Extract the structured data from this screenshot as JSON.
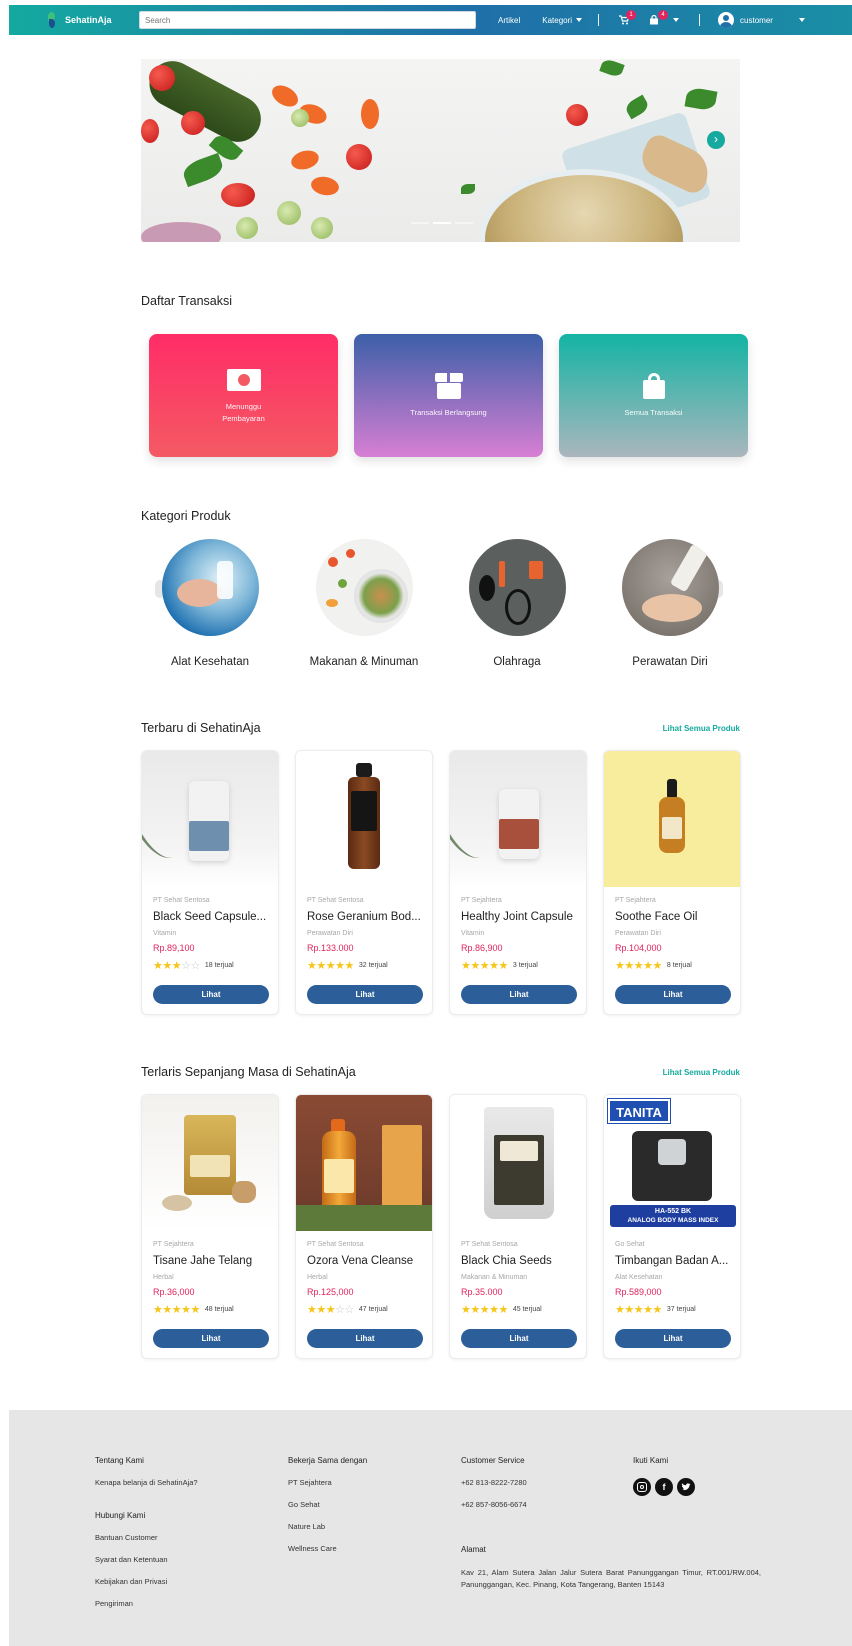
{
  "brand": {
    "name": "SehatinAja"
  },
  "navbar": {
    "search_placeholder": "Search",
    "artikel": "Artikel",
    "kategori": "Kategori",
    "cart_badge": "1",
    "bag_badge": "4",
    "user_name": "customer"
  },
  "transactions": {
    "title": "Daftar Transaksi",
    "cards": [
      {
        "label": "Menunggu Pembayaran",
        "icon": "money-icon"
      },
      {
        "label": "Transaksi Berlangsung",
        "icon": "box-icon"
      },
      {
        "label": "Semua Transaksi",
        "icon": "shopping-bag-icon"
      }
    ]
  },
  "categories": {
    "title": "Kategori Produk",
    "items": [
      {
        "label": "Alat Kesehatan"
      },
      {
        "label": "Makanan & Minuman"
      },
      {
        "label": "Olahraga"
      },
      {
        "label": "Perawatan Diri"
      }
    ]
  },
  "newest": {
    "title": "Terbaru di SehatinAja",
    "see_all": "Lihat Semua Produk",
    "products": [
      {
        "seller": "PT Sehat Sentosa",
        "name": "Black Seed Capsule...",
        "category": "Vitamin",
        "price": "Rp.89,100",
        "rating": 3,
        "sold": "18 terjual",
        "button": "Lihat"
      },
      {
        "seller": "PT Sehat Sentosa",
        "name": "Rose Geranium Bod...",
        "category": "Perawatan Diri",
        "price": "Rp.133.000",
        "rating": 5,
        "sold": "32 terjual",
        "button": "Lihat"
      },
      {
        "seller": "PT Sejahtera",
        "name": "Healthy Joint Capsule",
        "category": "Vitamin",
        "price": "Rp.86,900",
        "rating": 5,
        "sold": "3 terjual",
        "button": "Lihat"
      },
      {
        "seller": "PT Sejahtera",
        "name": "Soothe Face Oil",
        "category": "Perawatan Diri",
        "price": "Rp.104,000",
        "rating": 5,
        "sold": "8 terjual",
        "button": "Lihat"
      }
    ]
  },
  "bestseller": {
    "title": "Terlaris Sepanjang Masa di SehatinAja",
    "see_all": "Lihat Semua Produk",
    "products": [
      {
        "seller": "PT Sejahtera",
        "name": "Tisane Jahe Telang",
        "category": "Herbal",
        "price": "Rp.36,000",
        "rating": 5,
        "sold": "48 terjual",
        "button": "Lihat"
      },
      {
        "seller": "PT Sehat Sentosa",
        "name": "Ozora Vena Cleanse",
        "category": "Herbal",
        "price": "Rp.125,000",
        "rating": 3,
        "sold": "47 terjual",
        "button": "Lihat"
      },
      {
        "seller": "PT Sehat Sentosa",
        "name": "Black Chia Seeds",
        "category": "Makanan & Minuman",
        "price": "Rp.35.000",
        "rating": 5,
        "sold": "45 terjual",
        "button": "Lihat"
      },
      {
        "seller": "Go Sehat",
        "name": "Timbangan Badan A...",
        "category": "Alat Kesehatan",
        "price": "Rp.589,000",
        "rating": 5,
        "sold": "37 terjual",
        "button": "Lihat",
        "brand_text": "TANITA",
        "model_text": "HA-552 BK",
        "model_sub": "ANALOG BODY MASS INDEX"
      }
    ]
  },
  "footer": {
    "about": {
      "title": "Tentang Kami",
      "links": [
        "Kenapa belanja di SehatinAja?"
      ]
    },
    "contact": {
      "title": "Hubungi Kami",
      "links": [
        "Bantuan Customer",
        "Syarat dan Ketentuan",
        "Kebijakan dan Privasi",
        "Pengiriman"
      ]
    },
    "partners": {
      "title": "Bekerja Sama dengan",
      "links": [
        "PT Sejahtera",
        "Go Sehat",
        "Nature Lab",
        "Wellness Care"
      ]
    },
    "service": {
      "title": "Customer Service",
      "phones": [
        "+62 813-8222-7280",
        "+62 857-8056-6674"
      ]
    },
    "address": {
      "title": "Alamat",
      "text": "Kav 21, Alam Sutera Jalan Jalur Sutera Barat Panunggangan Timur, RT.001/RW.004, Panunggangan, Kec. Pinang, Kota Tangerang, Banten 15143"
    },
    "social": {
      "title": "Ikuti Kami",
      "icons": [
        "instagram-icon",
        "facebook-icon",
        "twitter-icon"
      ]
    }
  },
  "colors": {
    "accent": "#17a99f",
    "primary_button": "#2c5e9a",
    "price": "#e0245e",
    "star": "#f5c518"
  }
}
